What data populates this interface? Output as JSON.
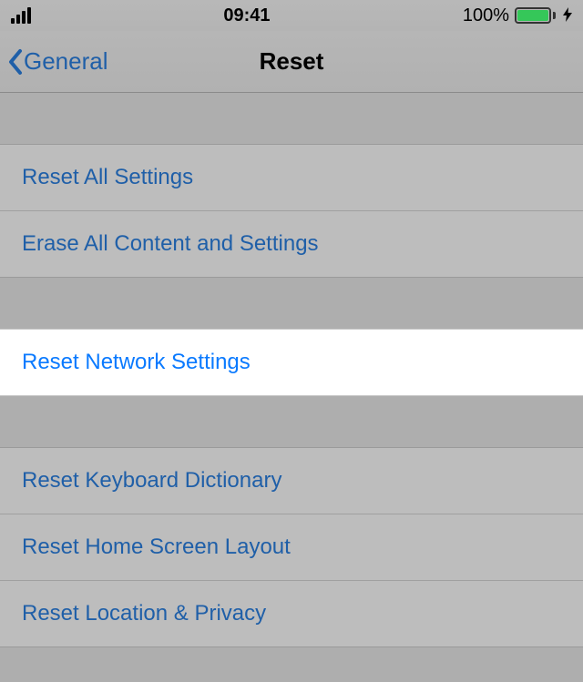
{
  "status": {
    "time": "09:41",
    "battery_percent": "100%"
  },
  "nav": {
    "back_label": "General",
    "title": "Reset"
  },
  "groups": [
    {
      "rows": [
        {
          "label": "Reset All Settings"
        },
        {
          "label": "Erase All Content and Settings"
        }
      ]
    },
    {
      "rows": [
        {
          "label": "Reset Network Settings",
          "highlight": true
        }
      ]
    },
    {
      "rows": [
        {
          "label": "Reset Keyboard Dictionary"
        },
        {
          "label": "Reset Home Screen Layout"
        },
        {
          "label": "Reset Location & Privacy"
        }
      ]
    }
  ]
}
